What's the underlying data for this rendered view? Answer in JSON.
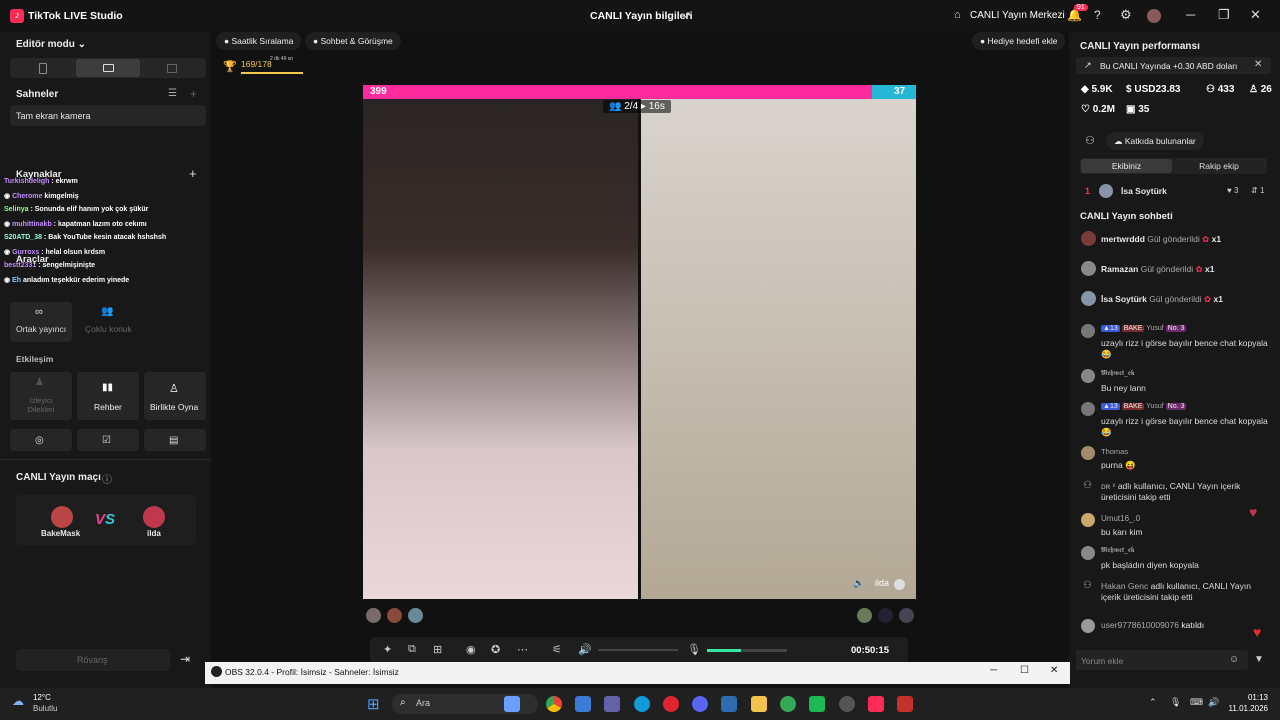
{
  "window": {
    "title": "TikTok LIVE Studio",
    "center_title": "CANLI Yayın bilgileri",
    "live_center": "CANLI Yayın Merkezi",
    "notif_count": "91"
  },
  "left": {
    "editor_mode": "Editör modu",
    "scenes": "Sahneler",
    "scene_item": "Tam ekran kamera",
    "sources": "Kaynaklar",
    "tools": "Araçlar",
    "cohost": "Ortak yayıncı",
    "multi_guest": "Çoklu konuk",
    "engagement": "Etkileşim",
    "viewer_wishes": "İzleyici Dilekleri",
    "guide": "Rehber",
    "play_together": "Birlikte Oyna",
    "match_title": "CANLI Yayın maçı",
    "player1": "BakeMask",
    "player2": "ilda",
    "rematch": "Rövanş",
    "chat_overlay": [
      {
        "user": "Turkishdeligh",
        "text": "ekrwm"
      },
      {
        "user": "Cherome",
        "text": "kimgelmiş"
      },
      {
        "user": "Selinya",
        "text": "Sonunda elif hanım yok çok şükür"
      },
      {
        "user": "muhittinakb",
        "text": "kapatman lazım oto cekımı"
      },
      {
        "user": "S20ATD_38",
        "text": "Bak YouTube kesin atacak hshshsh"
      },
      {
        "user": "Gurroxs",
        "text": "helal olsun krdsm"
      },
      {
        "user": "bestt2331",
        "text": "sengelmişinişte"
      },
      {
        "user": "Eh",
        "text": "anladım teşekkür ederim yinede"
      }
    ]
  },
  "center": {
    "tab1": "Saatlik Sıralama",
    "tab2": "Sohbet & Görüşme",
    "gift_goal": "Hediye hedefi ekle",
    "goal_progress": "169/178",
    "goal_timer": "2 dk 49 sn",
    "score_left": "399",
    "score_right": "37",
    "guest_count": "2/4",
    "timer": "16s",
    "guest_name": "ilda",
    "live_time": "00:50:15",
    "badge_left_a": "3",
    "badge_left_b": "2",
    "badge_right_a": "2",
    "badge_right_b": "3"
  },
  "right": {
    "perf_title": "CANLI Yayın performansı",
    "earn_banner": "Bu CANLI Yayında +0.30 ABD doları",
    "s1": "5.9K",
    "s2": "USD23.83",
    "s3": "433",
    "s4": "26",
    "s5": "0.2M",
    "s6": "35",
    "contributors": "Katkıda bulunanlar",
    "tab_team": "Ekibiniz",
    "tab_rival": "Rakip ekip",
    "rank1_name": "İsa Soytürk",
    "rank1_hearts": "3",
    "rank1_count": "1",
    "rank1_pos": "1",
    "chat_title": "CANLI Yayın sohbeti",
    "gifts": [
      {
        "user": "mertwrddd",
        "text": "Gül gönderildi",
        "x": "x1"
      },
      {
        "user": "Ramazan",
        "text": "Gül gönderildi",
        "x": "x1"
      },
      {
        "user": "İsa Soytürk",
        "text": "Gül gönderildi",
        "x": "x1"
      }
    ],
    "m1_user": "Yusuf",
    "m1_badge1": "13",
    "m1_badge2": "BAKE",
    "m1_badge3": "No. 3",
    "m1_text": "uzaylı rizz i görse bayılır bence chat kopyala 😂",
    "m2_user": "𝕸𝖊𝖍𝖒𝖊𝖙_𝖊𝖐",
    "m2_text": "Bu ney lann",
    "m3_text": "uzaylı rizz i görse bayılır bence chat kopyala 😂",
    "m4_user": "Thomas",
    "m4_text": "purna 😝",
    "m5_user": "ᴅʀ ˣ",
    "m5_text": "adlı kullanıcı, CANLI Yayın içerik üreticisini takip etti",
    "m6_user": "Umut16_.0",
    "m6_text": "bu karı kim",
    "m7_user": "𝕸𝖊𝖍𝖒𝖊𝖙_𝖊𝖐",
    "m7_text": "pk başladın diyen kopyala",
    "m8_user": "Hakan Genc",
    "m8_text": "adlı kullanıcı, CANLI Yayın içerik üreticisini takip etti",
    "m9_user": "user9778610009076",
    "m9_text": "katıldı",
    "comment_placeholder": "Yorum ekle"
  },
  "obs": {
    "title": "OBS 32.0.4 - Profil: İsimsiz - Sahneler: İsimsiz"
  },
  "taskbar": {
    "temp": "12°C",
    "weather": "Bulutlu",
    "search": "Ara",
    "time": "01:13",
    "date": "11.01.2026"
  }
}
